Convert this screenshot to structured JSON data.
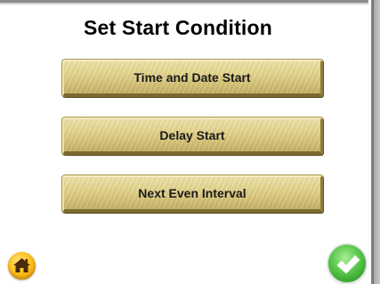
{
  "screen": {
    "title": "Set Start Condition"
  },
  "options": [
    {
      "label": "Time and Date Start"
    },
    {
      "label": "Delay Start"
    },
    {
      "label": "Next Even Interval"
    }
  ],
  "icons": {
    "home": "home-icon",
    "confirm": "checkmark-icon"
  },
  "colors": {
    "button_face": "#dccb82",
    "home_button": "#ffc21f",
    "confirm_button": "#5fcb4f"
  }
}
